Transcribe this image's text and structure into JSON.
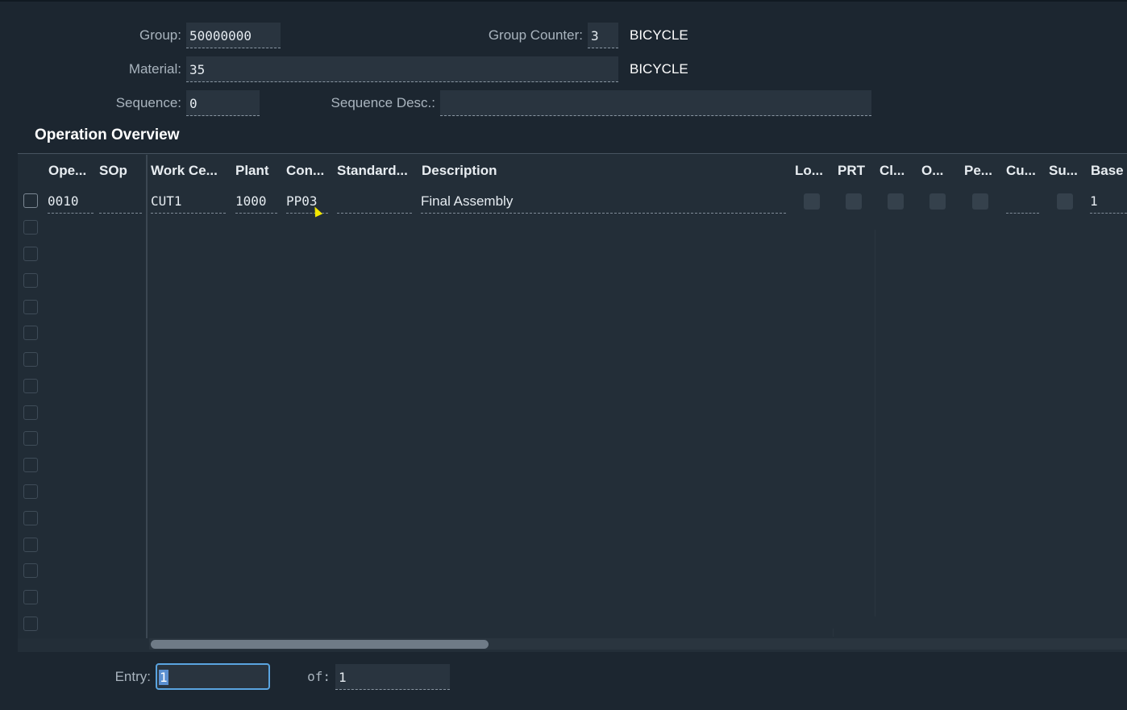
{
  "header": {
    "group_label": "Group:",
    "group_value": "50000000",
    "group_counter_label": "Group Counter:",
    "group_counter_value": "3",
    "group_desc": "BICYCLE",
    "material_label": "Material:",
    "material_value": "35",
    "material_desc": "BICYCLE",
    "sequence_label": "Sequence:",
    "sequence_value": "0",
    "sequence_desc_label": "Sequence Desc.:",
    "sequence_desc_value": ""
  },
  "section_title": "Operation Overview",
  "table": {
    "columns": [
      "Ope...",
      "SOp",
      "Work Ce...",
      "Plant",
      "Con...",
      "Standard...",
      "Description",
      "Lo...",
      "PRT",
      "Cl...",
      "O...",
      "Pe...",
      "Cu...",
      "Su...",
      "Base"
    ],
    "rows": [
      {
        "operation": "0010",
        "sop": "",
        "work_center": "CUT1",
        "plant": "1000",
        "control_key": "PP03",
        "standard_text": "",
        "description": "Final Assembly",
        "lo": false,
        "prt": false,
        "cl": false,
        "o": false,
        "pe": false,
        "cu": "",
        "su": false,
        "base": "1"
      }
    ]
  },
  "footer": {
    "entry_label": "Entry:",
    "entry_value": "1",
    "of_label": "of:",
    "of_value": "1"
  },
  "colors": {
    "background": "#1c2630",
    "field_bg": "#29343f",
    "focus_border": "#5aa4e0",
    "cursor": "#f2e600"
  }
}
